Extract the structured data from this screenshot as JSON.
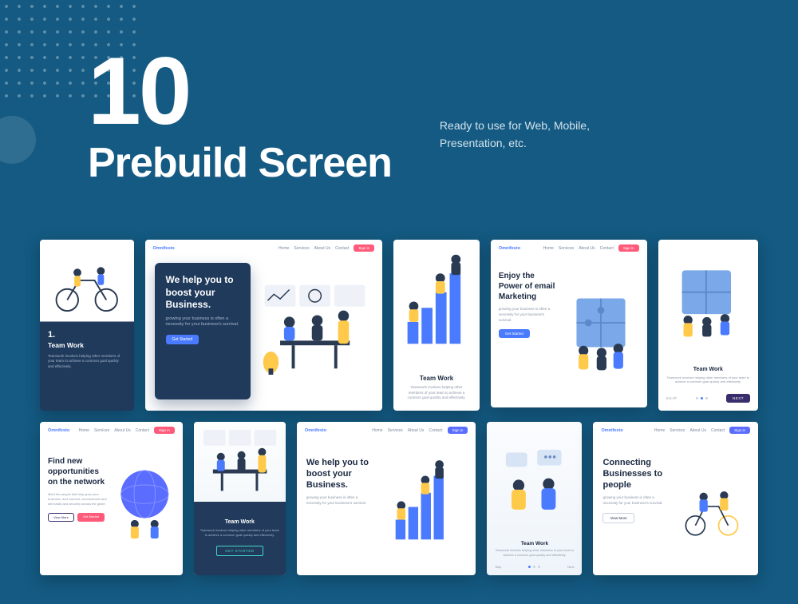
{
  "hero": {
    "number": "10",
    "title": "Prebuild Screen",
    "subtitle": "Ready to use for Web, Mobile, Presentation, etc."
  },
  "common": {
    "logo": "Omnifesto",
    "nav": {
      "home": "Home",
      "services": "Services",
      "about": "About Us",
      "contact": "Contact",
      "signin": "Sign in"
    },
    "teamwork_title": "Team Work",
    "teamwork_body": "Teamwork involves helping other members of your team to achieve a common goal quickly and effectively.",
    "boost_title": "We help you to boost your Business.",
    "boost_body": "growing your business is often a necessity for your business's survival.",
    "get_started": "Get Started",
    "get_started_upper": "GET STARTED"
  },
  "c1": {
    "num": "1."
  },
  "c4": {
    "title": "Enjoy the Power of email Marketing",
    "body": "growing your business is often a necessity for your business's survival."
  },
  "c5": {
    "skip": "SKIP",
    "next": "NEXT"
  },
  "c6": {
    "title": "Find new opportunities on the network",
    "body": "Meet the people that help grow your business, and connect, communicate and sell easily and securely across the globe.",
    "btn1": "View More",
    "btn2": "Get Started"
  },
  "c9": {
    "skip": "Skip",
    "next": "Next"
  },
  "c10": {
    "title": "Connecting Businesses to people",
    "body": "growing your business is often a necessity for your business's survival.",
    "btn": "View More"
  }
}
